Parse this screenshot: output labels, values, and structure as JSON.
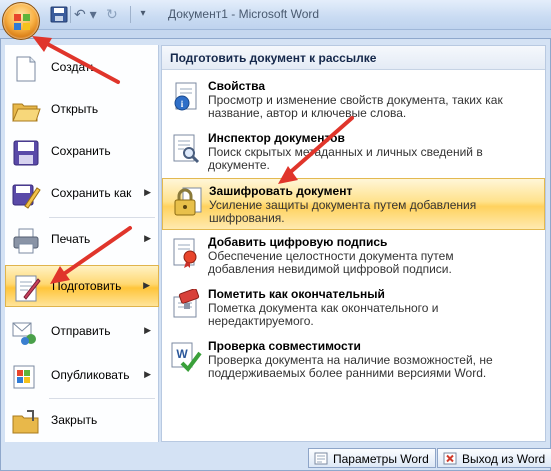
{
  "title_bar": {
    "title": "Документ1 - Microsoft Word"
  },
  "quick_access": {
    "save_icon": "save-icon",
    "undo_icon": "undo-icon",
    "redo_icon": "redo-icon",
    "customize_icon": "customize-qat-icon"
  },
  "office_button": {
    "icon": "office-logo-icon"
  },
  "left_menu": {
    "items": [
      {
        "label": "Создать",
        "icon": "new-document-icon",
        "has_submenu": false
      },
      {
        "label": "Открыть",
        "icon": "open-folder-icon",
        "has_submenu": false
      },
      {
        "label": "Сохранить",
        "icon": "save-icon",
        "has_submenu": false
      },
      {
        "label": "Сохранить как",
        "icon": "save-as-icon",
        "has_submenu": true
      },
      {
        "label": "Печать",
        "icon": "printer-icon",
        "has_submenu": true
      },
      {
        "label": "Подготовить",
        "icon": "prepare-icon",
        "has_submenu": true,
        "highlighted": true
      },
      {
        "label": "Отправить",
        "icon": "send-icon",
        "has_submenu": true
      },
      {
        "label": "Опубликовать",
        "icon": "publish-icon",
        "has_submenu": true
      },
      {
        "label": "Закрыть",
        "icon": "close-folder-icon",
        "has_submenu": false
      }
    ]
  },
  "right_pane": {
    "header": "Подготовить документ к рассылке",
    "items": [
      {
        "title": "Свойства",
        "desc": "Просмотр и изменение свойств документа, таких как название, автор и ключевые слова.",
        "icon": "properties-icon"
      },
      {
        "title": "Инспектор документов",
        "desc": "Поиск скрытых метаданных и личных сведений в документе.",
        "icon": "inspect-document-icon"
      },
      {
        "title": "Зашифровать документ",
        "desc": "Усиление защиты документа путем добавления шифрования.",
        "icon": "encrypt-lock-icon",
        "highlighted": true
      },
      {
        "title": "Добавить цифровую подпись",
        "desc": "Обеспечение целостности документа путем добавления невидимой цифровой подписи.",
        "icon": "digital-signature-icon"
      },
      {
        "title": "Пометить как окончательный",
        "desc": "Пометка документа как окончательного и нередактируемого.",
        "icon": "mark-final-icon"
      },
      {
        "title": "Проверка совместимости",
        "desc": "Проверка документа на наличие возможностей, не поддерживаемых более ранними версиями Word.",
        "icon": "compatibility-check-icon"
      }
    ]
  },
  "footer": {
    "options_label": "Параметры Word",
    "exit_label": "Выход из Word",
    "options_icon": "word-options-icon",
    "exit_icon": "exit-icon"
  },
  "annotations": {
    "arrow_color": "#e0352b"
  }
}
